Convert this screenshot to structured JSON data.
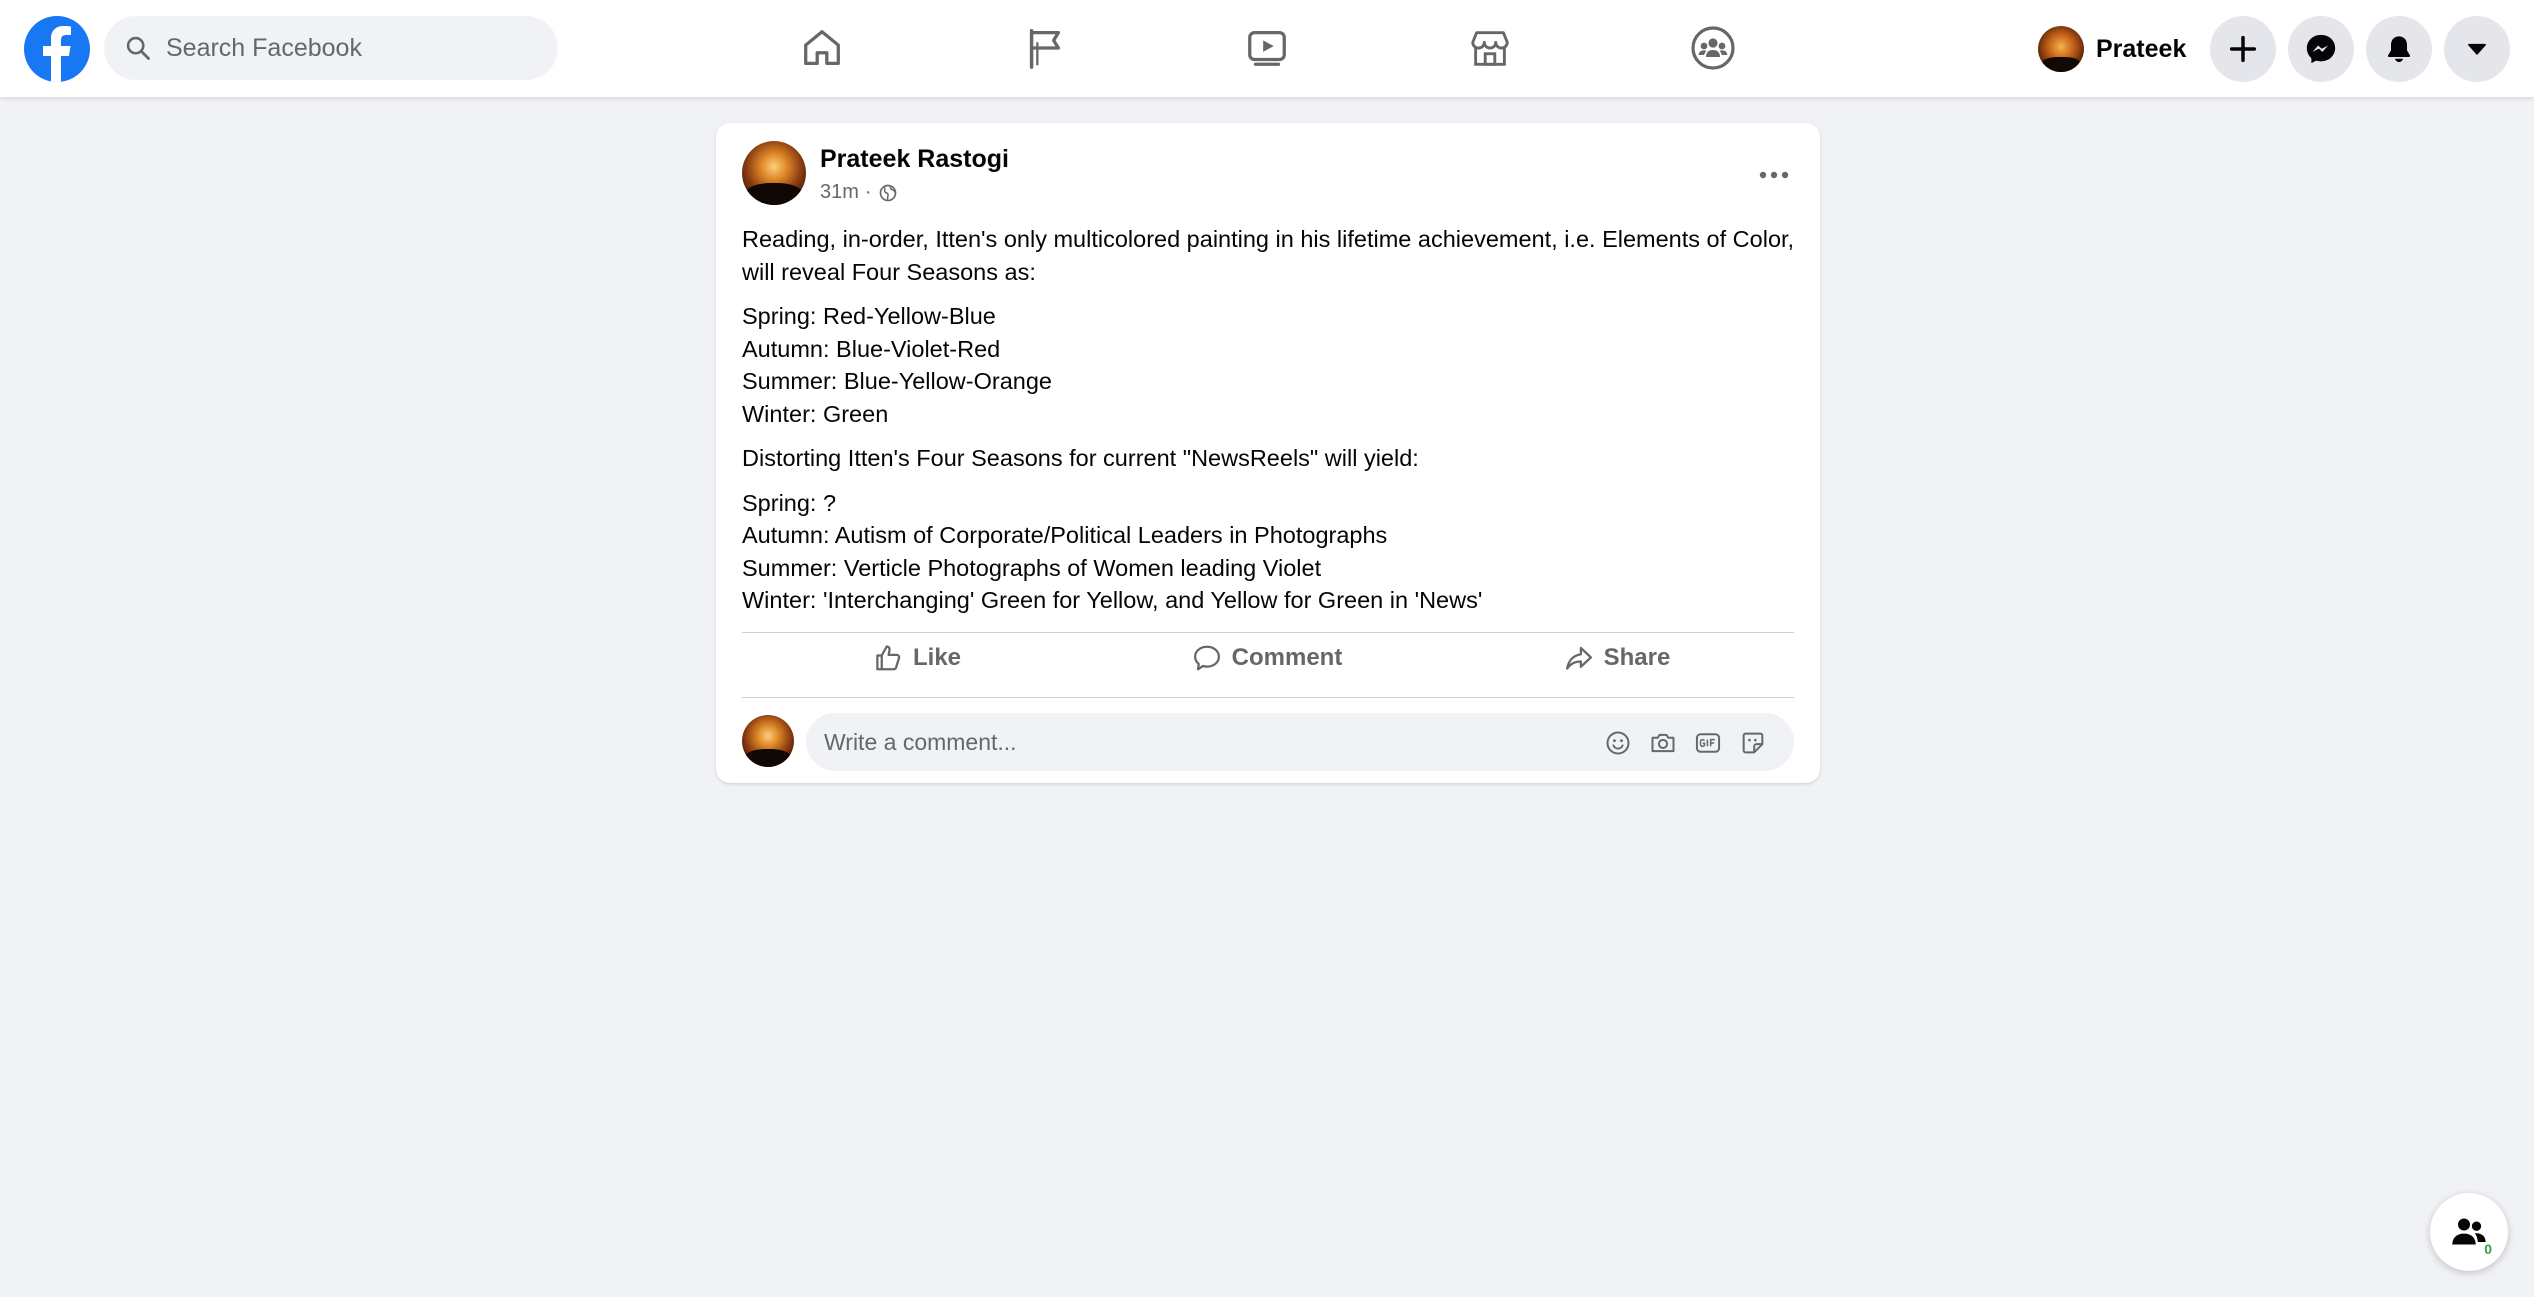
{
  "header": {
    "logo": "facebook-logo",
    "search": {
      "placeholder": "Search Facebook",
      "value": ""
    },
    "nav": [
      {
        "name": "home",
        "icon": "home-icon"
      },
      {
        "name": "pages",
        "icon": "flag-icon"
      },
      {
        "name": "watch",
        "icon": "video-icon"
      },
      {
        "name": "marketplace",
        "icon": "marketplace-icon"
      },
      {
        "name": "groups",
        "icon": "groups-icon"
      }
    ],
    "profile": {
      "name": "Prateek"
    },
    "actions": [
      "create-icon",
      "messenger-icon",
      "bell-icon",
      "chevron-down-icon"
    ]
  },
  "post": {
    "author": "Prateek Rastogi",
    "time": "31m",
    "separator": "·",
    "privacy_icon": "globe-icon",
    "paragraphs": [
      [
        "Reading, in-order, Itten's only multicolored painting in his lifetime achievement, i.e. Elements of Color, will reveal Four Seasons as:"
      ],
      [
        "Spring: Red-Yellow-Blue",
        "Autumn: Blue-Violet-Red",
        "Summer: Blue-Yellow-Orange",
        "Winter: Green"
      ],
      [
        "Distorting Itten's Four Seasons for current \"NewsReels\" will yield:"
      ],
      [
        "Spring: ?",
        "Autumn: Autism of Corporate/Political Leaders in Photographs",
        "Summer: Verticle Photographs of Women leading Violet",
        "Winter: 'Interchanging' Green for Yellow, and Yellow for Green in 'News'"
      ]
    ],
    "actions": {
      "like": "Like",
      "comment": "Comment",
      "share": "Share"
    },
    "comment_box": {
      "placeholder": "Write a comment...",
      "icons": [
        "emoji-icon",
        "camera-icon",
        "gif-icon",
        "sticker-icon"
      ]
    }
  },
  "contacts": {
    "count": "0"
  },
  "colors": {
    "brand": "#1877f2",
    "background": "#f0f2f5",
    "secondary_text": "#65676b",
    "online": "#31a24c"
  }
}
